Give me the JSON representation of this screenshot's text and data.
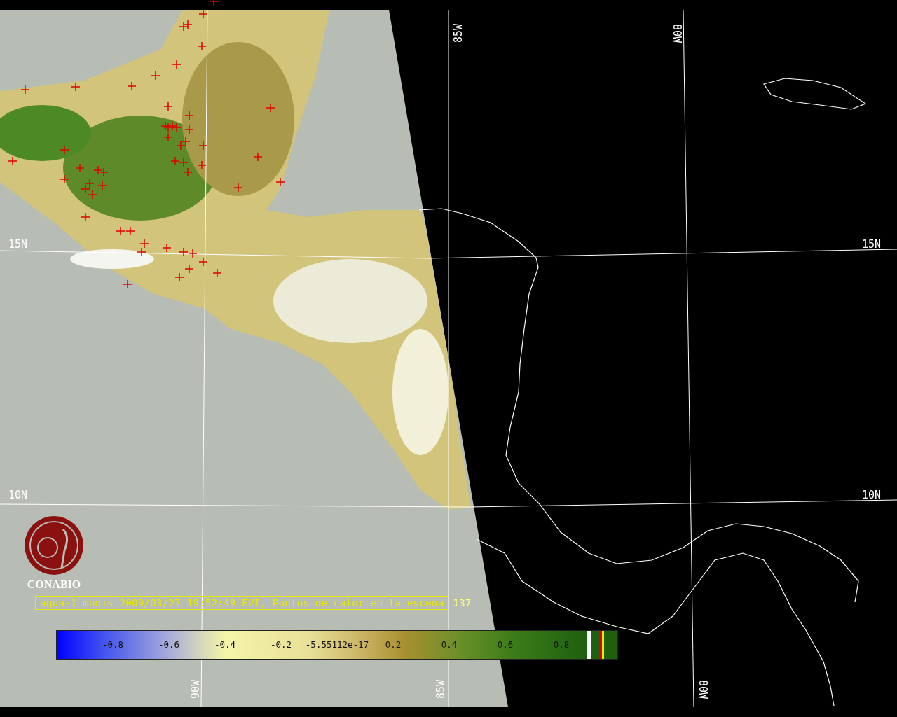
{
  "map": {
    "longitude_labels_top": [
      "85W",
      "80W"
    ],
    "latitude_labels": [
      "15N",
      "15N",
      "10N",
      "10N"
    ],
    "longitude_labels_bottom": [
      "90W",
      "85W",
      "80W"
    ]
  },
  "logo": {
    "name": "CONABIO"
  },
  "caption": {
    "text": "aqua-1 modis 2009/03/27 19:52:49 EVI, Puntos de calor en la escena",
    "count": "137"
  },
  "colorbar": {
    "ticks": [
      "-0.8",
      "-0.6",
      "-0.4",
      "-0.2",
      "-5.55112e-17",
      "0.2",
      "0.4",
      "0.6",
      "0.8"
    ]
  }
}
